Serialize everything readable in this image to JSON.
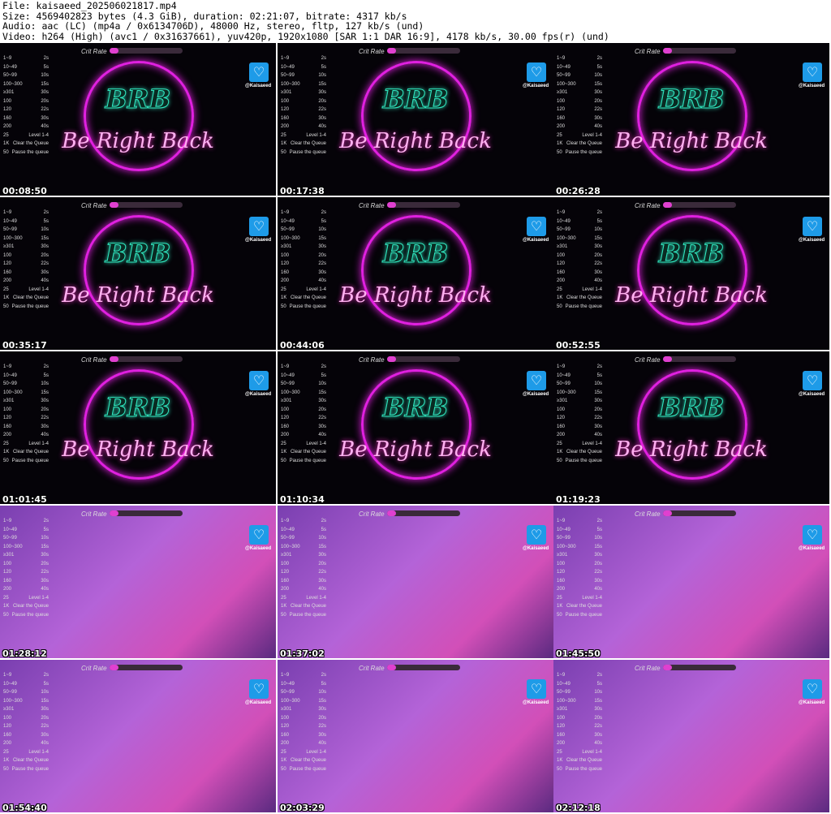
{
  "header": {
    "file": "File: kaisaeed_202506021817.mp4",
    "size": "Size: 4569402823 bytes (4.3 GiB), duration: 02:21:07, bitrate: 4317 kb/s",
    "audio": "Audio: aac (LC) (mp4a / 0x6134706D), 48000 Hz, stereo, fltp, 127 kb/s (und)",
    "video": "Video: h264 (High) (avc1 / 0x31637661), yuv420p, 1920x1080 [SAR 1:1 DAR 16:9], 4178 kb/s, 30.00 fps(r) (und)"
  },
  "overlay": {
    "crit_label": "Crit Rate",
    "handle": "@Kaisaeed",
    "brb": "BRB",
    "brb_sub": "Be Right Back",
    "menu": [
      [
        "1~9",
        "2s"
      ],
      [
        "10~49",
        "5s"
      ],
      [
        "50~99",
        "10s"
      ],
      [
        "100~300",
        "15s"
      ],
      [
        "≥301",
        "30s"
      ],
      [
        "",
        ""
      ],
      [
        "100",
        "20s"
      ],
      [
        "120",
        "22s"
      ],
      [
        "160",
        "30s"
      ],
      [
        "200",
        "40s"
      ],
      [
        "25",
        "Level 1-4"
      ],
      [
        "1K",
        "Clear the Queue"
      ],
      [
        "50",
        "Pause the queue"
      ]
    ]
  },
  "thumbnails": [
    {
      "time": "00:08:50",
      "scene": "brb"
    },
    {
      "time": "00:17:38",
      "scene": "brb"
    },
    {
      "time": "00:26:28",
      "scene": "brb"
    },
    {
      "time": "00:35:17",
      "scene": "brb"
    },
    {
      "time": "00:44:06",
      "scene": "brb"
    },
    {
      "time": "00:52:55",
      "scene": "brb"
    },
    {
      "time": "01:01:45",
      "scene": "brb"
    },
    {
      "time": "01:10:34",
      "scene": "brb"
    },
    {
      "time": "01:19:23",
      "scene": "brb"
    },
    {
      "time": "01:28:12",
      "scene": "cam"
    },
    {
      "time": "01:37:02",
      "scene": "cam"
    },
    {
      "time": "01:45:50",
      "scene": "cam"
    },
    {
      "time": "01:54:40",
      "scene": "cam"
    },
    {
      "time": "02:03:29",
      "scene": "cam"
    },
    {
      "time": "02:12:18",
      "scene": "cam"
    }
  ]
}
